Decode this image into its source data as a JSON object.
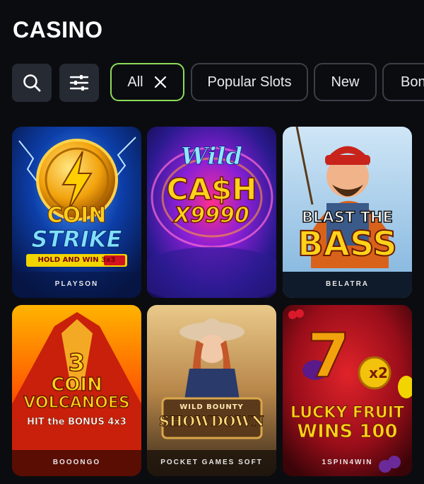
{
  "page": {
    "title": "CASINO"
  },
  "filters": {
    "search_icon": "search-icon",
    "settings_icon": "sliders-icon",
    "chips": [
      {
        "label": "All",
        "active": true
      },
      {
        "label": "Popular Slots",
        "active": false
      },
      {
        "label": "New",
        "active": false
      },
      {
        "label": "Bon",
        "active": false
      }
    ]
  },
  "games": [
    {
      "l1": "COIN",
      "l2": "STRIKE",
      "l3": "HOLD AND WIN 3x3",
      "provider": "PLAYSON"
    },
    {
      "l1": "Wild",
      "l2": "CA$H",
      "l3": "X9990",
      "provider": ""
    },
    {
      "l1": "BLAST THE",
      "l2": "BASS",
      "provider": "BELATRA"
    },
    {
      "l1": "3",
      "l2": "COIN",
      "l3": "VOLCANOES",
      "l4": "HIT the BONUS 4x3",
      "provider": "BOOONGO"
    },
    {
      "l1": "WILD BOUNTY",
      "l2": "SHOWDOWN",
      "provider": "POCKET GAMES SOFT"
    },
    {
      "l1": "7",
      "l2": "x2",
      "l3": "LUCKY FRUIT",
      "l4": "WINS 100",
      "provider": "1SPIN4WIN"
    }
  ],
  "colors": {
    "background": "#0b0c10",
    "active_chip_border": "#8ddb5a",
    "chip_border": "#3b3f47"
  }
}
